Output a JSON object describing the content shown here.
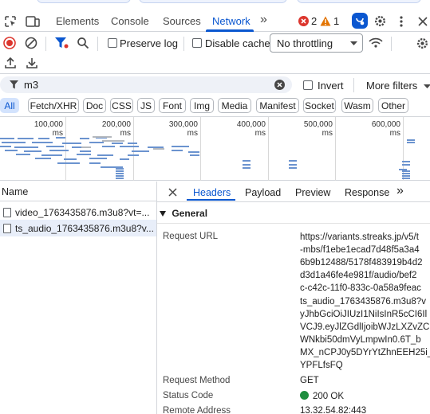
{
  "tabs": {
    "elements": "Elements",
    "console": "Console",
    "sources": "Sources",
    "network": "Network",
    "more": "»"
  },
  "badges": {
    "errors": "2",
    "warnings": "1"
  },
  "toolbar": {
    "preserve_log": "Preserve log",
    "disable_cache": "Disable cache",
    "throttling": "No throttling"
  },
  "filter": {
    "value": "m3",
    "invert": "Invert",
    "more_filters": "More filters"
  },
  "type_filters": [
    "All",
    "Fetch/XHR",
    "Doc",
    "CSS",
    "JS",
    "Font",
    "Img",
    "Media",
    "Manifest",
    "Socket",
    "Wasm",
    "Other"
  ],
  "timeline": {
    "ticks": [
      "100,000 ms",
      "200,000 ms",
      "300,000 ms",
      "400,000 ms",
      "500,000 ms",
      "600,000 ms"
    ]
  },
  "requests": {
    "header": "Name",
    "rows": [
      {
        "name": "video_1763435876.m3u8?vt=..."
      },
      {
        "name": "ts_audio_1763435876.m3u8?v..."
      }
    ]
  },
  "details": {
    "tabs": [
      "Headers",
      "Payload",
      "Preview",
      "Response",
      "»"
    ],
    "section": "General",
    "request_url_label": "Request URL",
    "request_url_lines": [
      "https://variants.streaks.jp/v5/t",
      "-mbs/f1ebe1ecad7d48f5a3a4",
      "6b9b12488/5178f483919b4d2",
      "d3d1a46fe4e981f/audio/bef2",
      "c-c42c-11f0-833c-0a58a9feac",
      "ts_audio_1763435876.m3u8?v",
      "yJhbGciOiJIUzI1NiIsInR5cCI6Il",
      "VCJ9.eyJlZGdlIjoibWJzLXZvZC",
      "WNkbi50dmVyLmpwIn0.6T_b",
      "MX_nCPJ0y5DYrYtZhnEEH25i_",
      "YPFLfsFQ"
    ],
    "request_method_label": "Request Method",
    "request_method": "GET",
    "status_code_label": "Status Code",
    "status_code": "200 OK",
    "remote_address_label": "Remote Address",
    "remote_address": "13.32.54.82:443"
  },
  "colors": {
    "accent": "#0b57d0",
    "error": "#dc362e",
    "warning": "#e37400",
    "status_ok": "#1e8e3e",
    "waterfall": "#6b93cf"
  }
}
